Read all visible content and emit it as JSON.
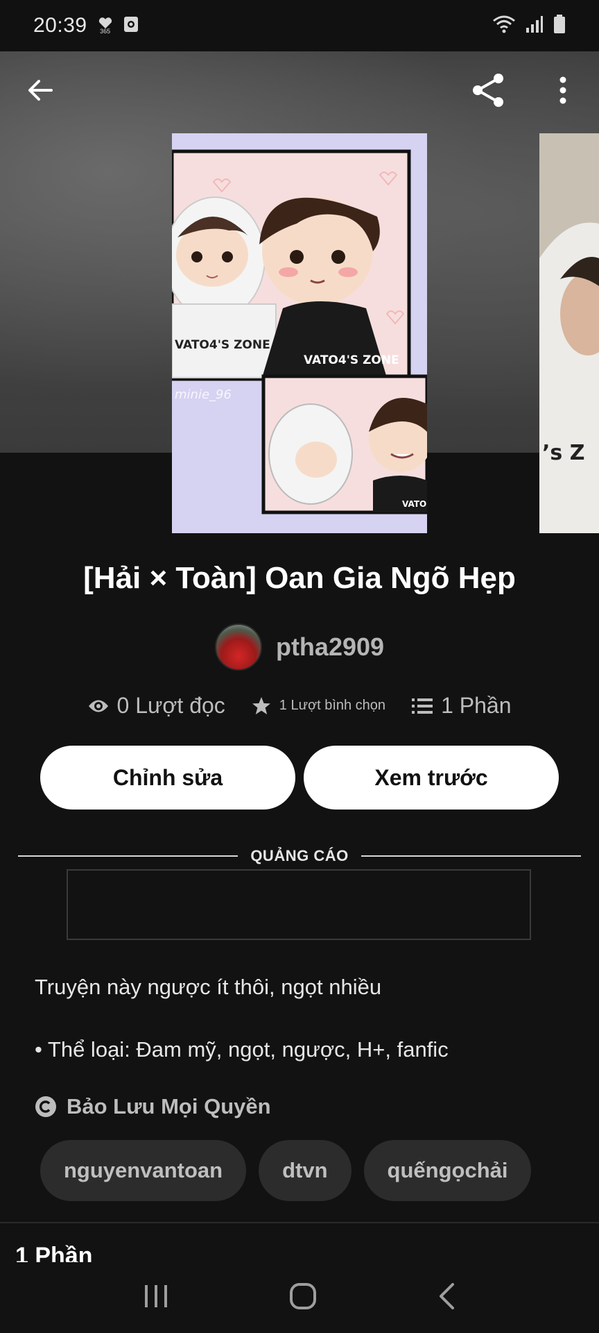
{
  "status_bar": {
    "time": "20:39",
    "health_badge": "365",
    "icons": [
      "heart-icon",
      "app-notification-icon",
      "wifi-icon",
      "signal-icon",
      "battery-icon"
    ]
  },
  "toolbar": {
    "icons": [
      "back-arrow-icon",
      "share-icon",
      "more-vertical-icon"
    ]
  },
  "story": {
    "title": "[Hải × Toàn] Oan Gia Ngõ Hẹp",
    "author": "ptha2909",
    "stats": {
      "reads": "0 Lượt đọc",
      "votes": "1 Lượt bình chọn",
      "parts": "1 Phần"
    }
  },
  "cover_art": {
    "shirt_text_1": "VATO4'S ZONE",
    "shirt_text_2": "VATO4'S ZONE",
    "shirt_text_3": "VATO",
    "watermark": "minie_96",
    "side_cover_text": "ʼs Z"
  },
  "actions": {
    "edit_label": "Chỉnh sửa",
    "preview_label": "Xem trước"
  },
  "ad": {
    "label": "QUẢNG CÁO"
  },
  "description": {
    "line1": "Truyện này ngược ít thôi, ngọt nhiều",
    "line2": "• Thể loại: Đam mỹ, ngọt, ngược, H+, fanfic"
  },
  "copyright": {
    "label": "Bảo Lưu Mọi Quyền"
  },
  "tags": [
    "nguyenvantoan",
    "dtvn",
    "quếngọchải"
  ],
  "parts_section": {
    "title": "1 Phần"
  },
  "colors": {
    "background": "#121212",
    "button_bg": "#ffffff",
    "tag_bg": "#2c2c2c",
    "muted_text": "#bdbdbd"
  }
}
